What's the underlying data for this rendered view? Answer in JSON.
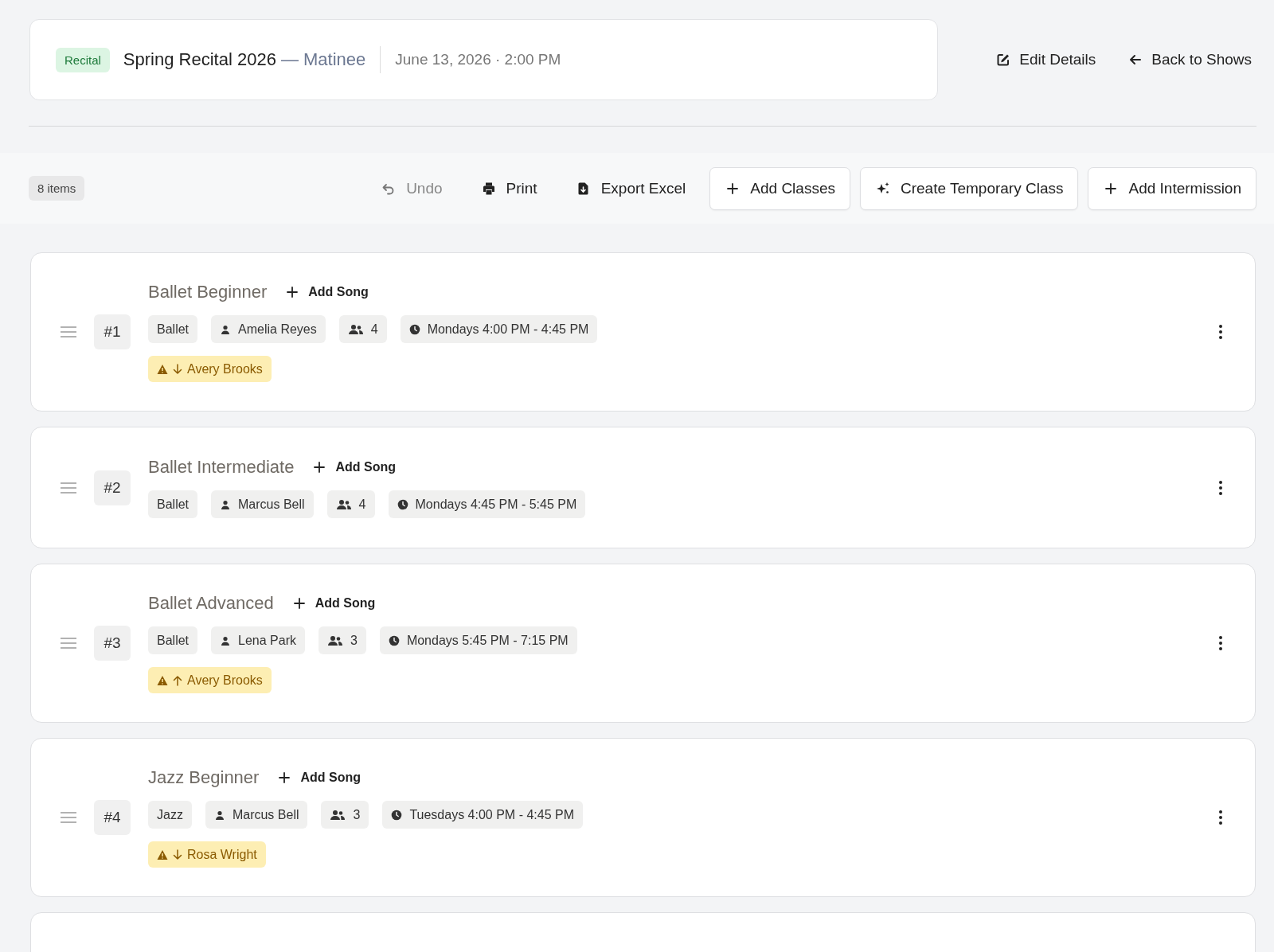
{
  "header": {
    "badge": "Recital",
    "title": "Spring Recital 2026",
    "subtitle": "— Matinee",
    "date": "June 13, 2026 · 2:00 PM"
  },
  "header_actions": [
    {
      "label": "Edit Details"
    },
    {
      "label": "Back to Shows"
    }
  ],
  "toolbar": {
    "count": "8 items",
    "actions": [
      {
        "label": "Undo",
        "kind": "plain",
        "disabled": true
      },
      {
        "label": "Print",
        "kind": "plain",
        "disabled": false
      },
      {
        "label": "Export Excel",
        "kind": "plain",
        "disabled": false
      },
      {
        "label": "Add Classes",
        "kind": "outlined",
        "disabled": false
      },
      {
        "label": "Create Temporary Class",
        "kind": "outlined",
        "disabled": false
      },
      {
        "label": "Add Intermission",
        "kind": "outlined",
        "disabled": false
      }
    ]
  },
  "items": [
    {
      "number": "#1",
      "name": "Ballet Beginner",
      "add_song": "Add Song",
      "style": "Ballet",
      "teacher": "Amelia Reyes",
      "students": "4",
      "schedule": "Mondays 4:00 PM - 4:45 PM",
      "warnings": [
        {
          "kind": "down",
          "name": "Avery Brooks"
        }
      ]
    },
    {
      "number": "#2",
      "name": "Ballet Intermediate",
      "add_song": "Add Song",
      "style": "Ballet",
      "teacher": "Marcus Bell",
      "students": "4",
      "schedule": "Mondays 4:45 PM - 5:45 PM"
    },
    {
      "number": "#3",
      "name": "Ballet Advanced",
      "add_song": "Add Song",
      "style": "Ballet",
      "teacher": "Lena Park",
      "students": "3",
      "schedule": "Mondays 5:45 PM - 7:15 PM",
      "warnings": [
        {
          "kind": "up",
          "name": "Avery Brooks"
        }
      ]
    },
    {
      "number": "#4",
      "name": "Jazz Beginner",
      "add_song": "Add Song",
      "style": "Jazz",
      "teacher": "Marcus Bell",
      "students": "3",
      "schedule": "Tuesdays 4:00 PM - 4:45 PM",
      "warnings": [
        {
          "kind": "down",
          "name": "Rosa Wright"
        }
      ]
    }
  ]
}
